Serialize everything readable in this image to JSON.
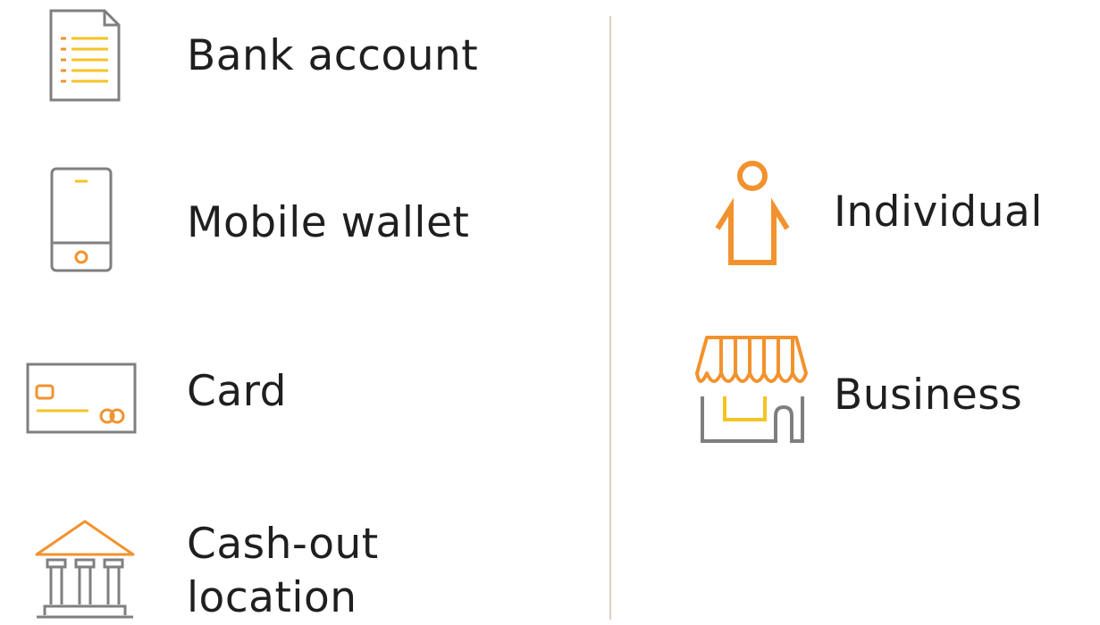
{
  "colors": {
    "gray": "#7f7f7f",
    "orange": "#f2922e",
    "yellow": "#f5c324",
    "divider": "#d8d0c2"
  },
  "left_column": {
    "items": [
      {
        "label": "Bank account",
        "icon": "document-list-icon"
      },
      {
        "label": "Mobile wallet",
        "icon": "mobile-phone-icon"
      },
      {
        "label": "Card",
        "icon": "credit-card-icon"
      },
      {
        "label_line1": "Cash-out",
        "label_line2": "location",
        "icon": "bank-building-icon"
      }
    ]
  },
  "right_column": {
    "items": [
      {
        "label": "Individual",
        "icon": "person-icon"
      },
      {
        "label": "Business",
        "icon": "storefront-icon"
      }
    ]
  }
}
